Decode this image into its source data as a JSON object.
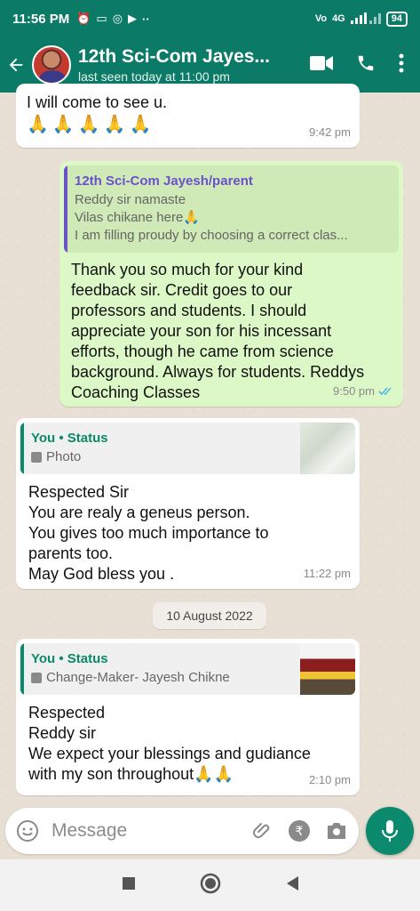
{
  "status_bar": {
    "time": "11:56 PM",
    "battery": "94",
    "network_label": "4G"
  },
  "header": {
    "title": "12th Sci-Com Jayes...",
    "subtitle": "last seen today at 11:00 pm"
  },
  "messages": [
    {
      "text": "I will come to see u.",
      "emoji": "🙏🙏🙏🙏🙏",
      "time": "9:42 pm"
    },
    {
      "quote_name": "12th Sci-Com Jayesh/parent",
      "quote_lines": [
        "Reddy sir namaste",
        "Vilas chikane here🙏",
        "I am filling proudy by  choosing a correct clas..."
      ],
      "text": "Thank you so much for your kind\nfeedback sir. Credit goes to our\nprofessors and students. I should\nappreciate your son for his incessant\nefforts, though he came from science\nbackground. Always for students. Reddys\nCoaching Classes",
      "time": "9:50 pm"
    },
    {
      "quote_name": "You • Status",
      "quote_sub": "Photo",
      "text": "Respected Sir\nYou are realy a geneus person.\nYou gives too much  importance to\nparents too.\nMay God bless you .",
      "time": "11:22 pm"
    },
    {
      "quote_name": "You • Status",
      "quote_sub": "Change-Maker- Jayesh Chikne",
      "text": "Respected\n Reddy sir\nWe expect your blessings and gudiance\nwith my son throughout🙏🙏",
      "time": "2:10 pm"
    }
  ],
  "date_chip": "10 August 2022",
  "input": {
    "placeholder": "Message"
  },
  "colors": {
    "header": "#0b7a66",
    "incoming": "#ffffff",
    "outgoing": "#dcf8c6",
    "quote_bar_purple": "#6b52c9",
    "quote_name_teal": "#0a8a6a",
    "tick_blue": "#4fb6ec"
  }
}
